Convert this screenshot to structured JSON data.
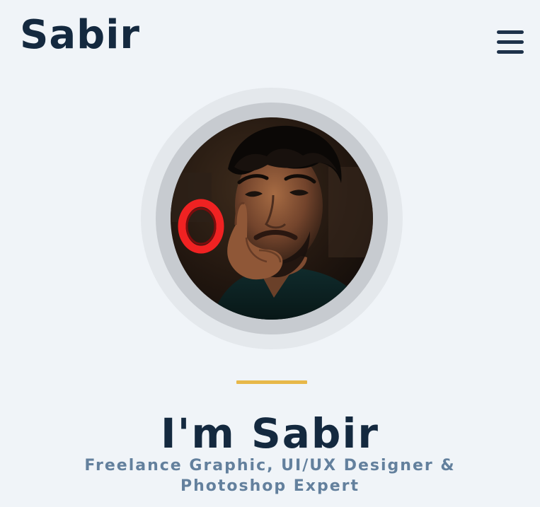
{
  "header": {
    "brand": "Sabir",
    "menu_icon": "hamburger-menu-icon"
  },
  "hero": {
    "avatar": "portrait-photo",
    "title": "I'm Sabir",
    "subtitle_line1": "Freelance Graphic, UI/UX Designer &",
    "subtitle_line2": "Photoshop Expert"
  },
  "colors": {
    "background": "#f0f4f8",
    "primary_text": "#14293f",
    "secondary_text": "#63809d",
    "accent": "#e7b84a",
    "outer_ring": "#e4e8ec",
    "inner_ring": "#c7cbd0"
  }
}
